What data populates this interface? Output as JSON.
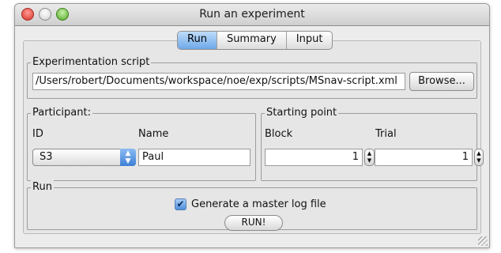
{
  "window": {
    "title": "Run an experiment"
  },
  "tabs": [
    "Run",
    "Summary",
    "Input"
  ],
  "active_tab": "Run",
  "script_group": {
    "legend": "Experimentation script",
    "path": "/Users/robert/Documents/workspace/noe/exp/scripts/MSnav-script.xml",
    "browse_label": "Browse..."
  },
  "participant_group": {
    "legend": "Participant:",
    "id_label": "ID",
    "name_label": "Name",
    "id_value": "S3",
    "name_value": "Paul"
  },
  "starting_point_group": {
    "legend": "Starting point",
    "block_label": "Block",
    "trial_label": "Trial",
    "block_value": "1",
    "trial_value": "1"
  },
  "run_group": {
    "legend": "Run",
    "master_log_label": "Generate a master log file",
    "master_log_checked": true,
    "run_button": "RUN!"
  },
  "icons": {
    "close": "close-icon",
    "minimize": "minimize-icon",
    "zoom": "zoom-icon",
    "select_arrows": "up-down-arrows-icon",
    "stepper": "stepper-icon",
    "check": "checkmark-icon",
    "resize": "resize-grip-icon"
  }
}
